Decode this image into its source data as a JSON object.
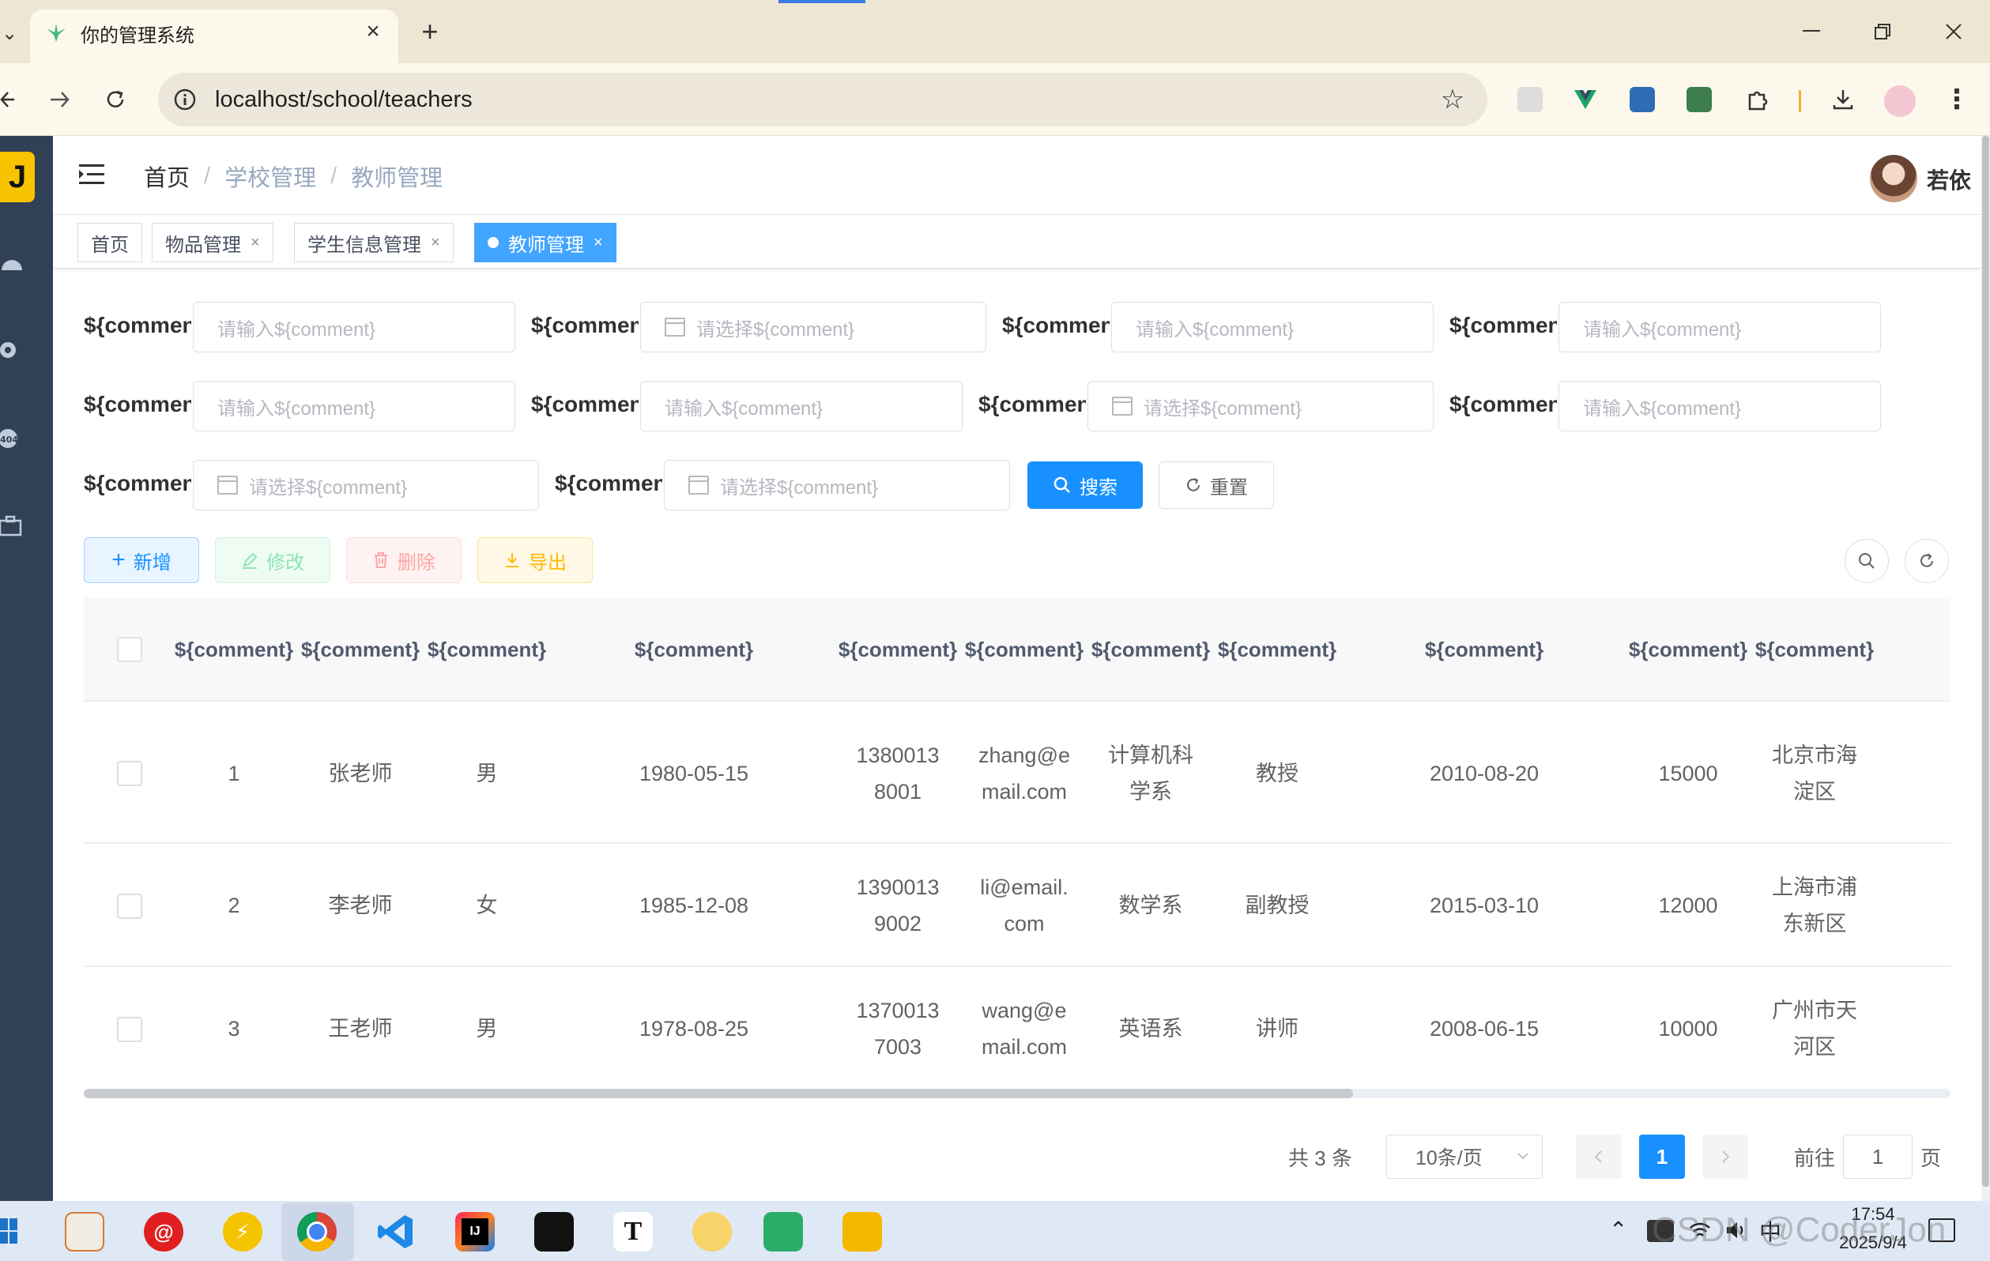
{
  "browser": {
    "tab_title": "你的管理系统",
    "url": "localhost/school/teachers",
    "new_tab_symbol": "+",
    "close_symbol": "×"
  },
  "header": {
    "breadcrumb": [
      "首页",
      "学校管理",
      "教师管理"
    ],
    "breadcrumb_sep": "/",
    "username": "若依"
  },
  "tags": [
    {
      "label": "首页",
      "closable": false,
      "active": false
    },
    {
      "label": "物品管理",
      "closable": true,
      "active": false
    },
    {
      "label": "学生信息管理",
      "closable": true,
      "active": false
    },
    {
      "label": "教师管理",
      "closable": true,
      "active": true
    }
  ],
  "tag_close": "×",
  "search_form": {
    "label": "${comment}",
    "input_placeholder": "请输入${comment}",
    "select_placeholder": "请选择${comment}",
    "search_button": "搜索",
    "reset_button": "重置"
  },
  "toolbar": {
    "add": "新增",
    "edit": "修改",
    "delete": "删除",
    "export": "导出"
  },
  "table": {
    "headers": [
      "${comment}",
      "${comment}",
      "${comment}",
      "${comment}",
      "${comment}",
      "${comment}",
      "${comment}",
      "${comment}",
      "${comment}",
      "${comment}",
      "${comment}"
    ],
    "rows": [
      [
        "1",
        "张老师",
        "男",
        "1980-05-15",
        "13800138001",
        "zhang@email.com",
        "计算机科学系",
        "教授",
        "2010-08-20",
        "15000",
        "北京市海淀区"
      ],
      [
        "2",
        "李老师",
        "女",
        "1985-12-08",
        "13900139002",
        "li@email.com",
        "数学系",
        "副教授",
        "2015-03-10",
        "12000",
        "上海市浦东新区"
      ],
      [
        "3",
        "王老师",
        "男",
        "1978-08-25",
        "13700137003",
        "wang@email.com",
        "英语系",
        "讲师",
        "2008-06-15",
        "10000",
        "广州市天河区"
      ]
    ],
    "scroll_position": 0.68
  },
  "pagination": {
    "total_text": "共 3 条",
    "page_size": "10条/页",
    "current_page": "1",
    "goto_prefix": "前往",
    "goto_value": "1",
    "goto_suffix": "页"
  },
  "taskbar": {
    "ime": "中",
    "time": "17:54",
    "date": "2025/9/4",
    "watermark": "CSDN @CoderJon"
  },
  "colors": {
    "primary": "#1890ff",
    "sidebar": "#304156",
    "success": "#13ce66",
    "danger": "#ff4949",
    "warning": "#ffba00"
  }
}
